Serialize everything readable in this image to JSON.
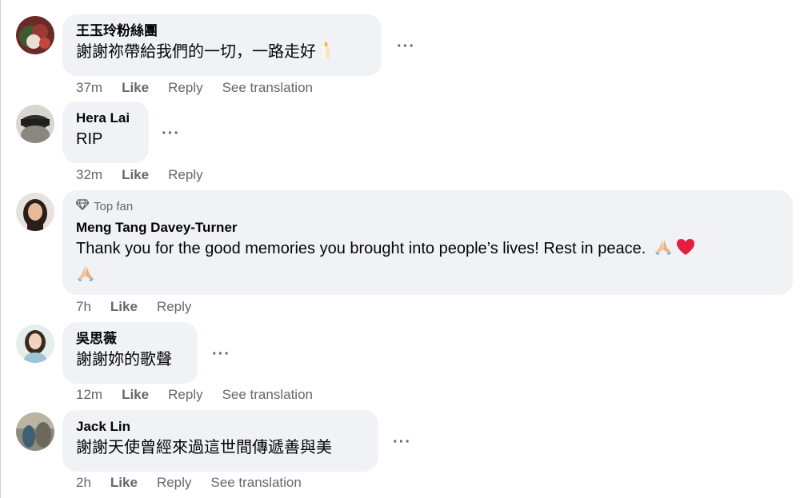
{
  "comments": [
    {
      "author": "王玉玲粉絲團",
      "text": "謝謝祢帶給我們的一切，一路走好",
      "time": "37m",
      "like": "Like",
      "reply": "Reply",
      "see_translation": "See translation"
    },
    {
      "author": "Hera Lai",
      "text": "RIP",
      "time": "32m",
      "like": "Like",
      "reply": "Reply"
    },
    {
      "badge": "Top fan",
      "author": "Meng Tang Davey-Turner",
      "text": "Thank you for the good memories you brought into people’s lives! Rest in peace.",
      "time": "7h",
      "like": "Like",
      "reply": "Reply"
    },
    {
      "author": "吳思薇",
      "text": "謝謝妳的歌聲",
      "time": "12m",
      "like": "Like",
      "reply": "Reply",
      "see_translation": "See translation"
    },
    {
      "author": "Jack Lin",
      "text": "謝謝天使曾經來過這世間傳遞善與美",
      "time": "2h",
      "like": "Like",
      "reply": "Reply",
      "see_translation": "See translation"
    }
  ],
  "more_label": "···",
  "colors": {
    "bubble": "#f0f2f5",
    "secondary_text": "#65676b",
    "primary_text": "#050505",
    "heart": "#e41e3f"
  },
  "icons": [
    "candle-icon",
    "praying-hands-icon",
    "heart-icon",
    "top-fan-diamond-icon",
    "more-options-icon"
  ]
}
